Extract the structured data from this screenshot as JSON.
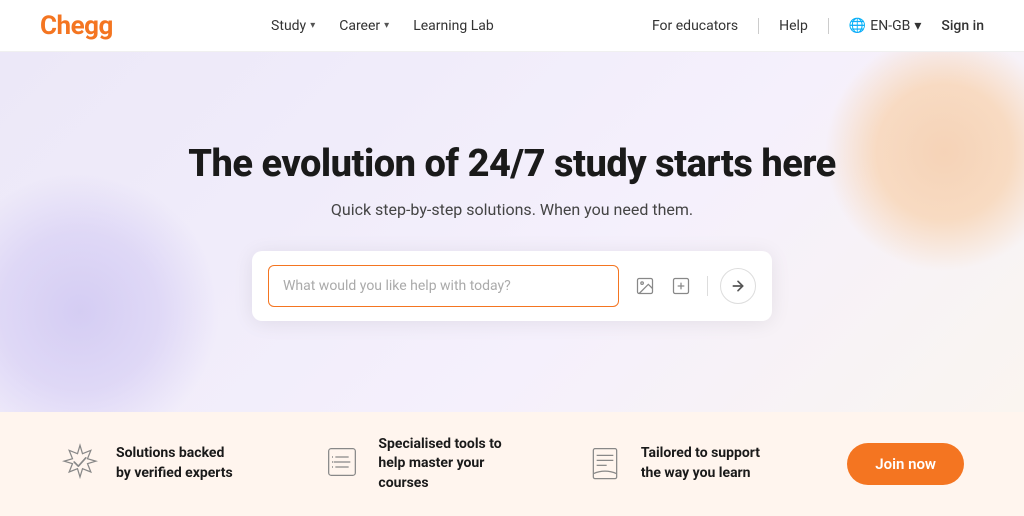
{
  "navbar": {
    "logo": "Chegg",
    "nav_items": [
      {
        "label": "Study",
        "has_dropdown": true
      },
      {
        "label": "Career",
        "has_dropdown": true
      },
      {
        "label": "Learning Lab",
        "has_dropdown": false
      }
    ],
    "right_items": {
      "for_educators": "For educators",
      "help": "Help",
      "lang": "EN-GB",
      "signin": "Sign in"
    }
  },
  "hero": {
    "title": "The evolution of 24/7 study starts here",
    "subtitle": "Quick step-by-step solutions. When you need them.",
    "search_placeholder": "What would you like help with today?"
  },
  "bottom_banner": {
    "features": [
      {
        "icon": "verified-expert-icon",
        "text": "Solutions backed by verified experts"
      },
      {
        "icon": "tools-icon",
        "text": "Specialised tools to help master your courses"
      },
      {
        "icon": "learn-icon",
        "text": "Tailored to support the way you learn"
      }
    ],
    "join_label": "Join now"
  },
  "colors": {
    "brand_orange": "#f47521",
    "hero_bg_left": "#ece8f8",
    "hero_bg_right": "#faf5f0",
    "bottom_bg": "#fff5ee"
  }
}
